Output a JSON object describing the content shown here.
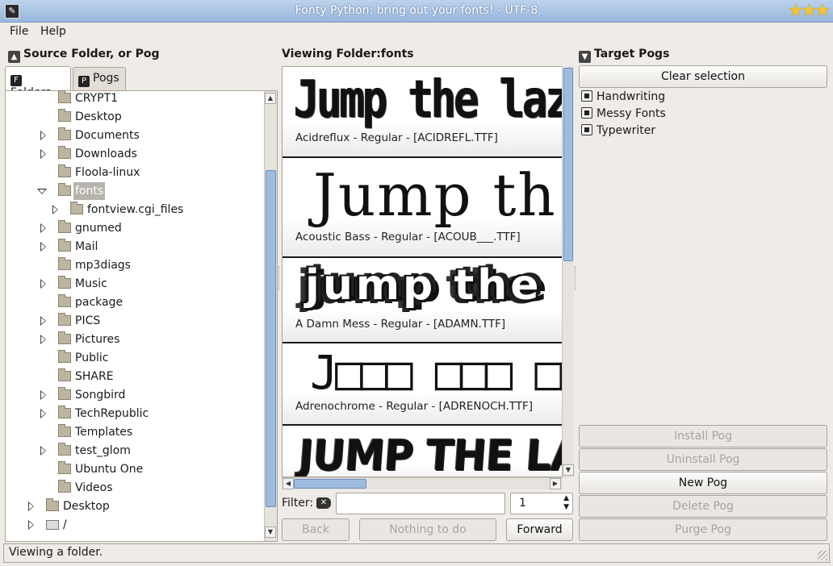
{
  "window": {
    "title": "Fonty Python: bring out your fonts!   -   UTF-8"
  },
  "menu": [
    {
      "label": "File"
    },
    {
      "label": "Help"
    }
  ],
  "source": {
    "heading": "Source Folder, or Pog",
    "tabs": [
      {
        "label": "Folders",
        "active": true
      },
      {
        "label": "Pogs",
        "active": false
      }
    ],
    "tree": [
      {
        "label": "CRYPT1",
        "depth": 1,
        "expander": "none"
      },
      {
        "label": "Desktop",
        "depth": 1,
        "expander": "none"
      },
      {
        "label": "Documents",
        "depth": 1,
        "expander": "closed"
      },
      {
        "label": "Downloads",
        "depth": 1,
        "expander": "closed"
      },
      {
        "label": "Floola-linux",
        "depth": 1,
        "expander": "none"
      },
      {
        "label": "fonts",
        "depth": 1,
        "expander": "open",
        "selected": true
      },
      {
        "label": "fontview.cgi_files",
        "depth": 2,
        "expander": "closed"
      },
      {
        "label": "gnumed",
        "depth": 1,
        "expander": "closed"
      },
      {
        "label": "Mail",
        "depth": 1,
        "expander": "closed"
      },
      {
        "label": "mp3diags",
        "depth": 1,
        "expander": "none"
      },
      {
        "label": "Music",
        "depth": 1,
        "expander": "closed"
      },
      {
        "label": "package",
        "depth": 1,
        "expander": "none"
      },
      {
        "label": "PICS",
        "depth": 1,
        "expander": "closed"
      },
      {
        "label": "Pictures",
        "depth": 1,
        "expander": "closed"
      },
      {
        "label": "Public",
        "depth": 1,
        "expander": "none"
      },
      {
        "label": "SHARE",
        "depth": 1,
        "expander": "none"
      },
      {
        "label": "Songbird",
        "depth": 1,
        "expander": "closed"
      },
      {
        "label": "TechRepublic",
        "depth": 1,
        "expander": "closed"
      },
      {
        "label": "Templates",
        "depth": 1,
        "expander": "none"
      },
      {
        "label": "test_glom",
        "depth": 1,
        "expander": "closed"
      },
      {
        "label": "Ubuntu One",
        "depth": 1,
        "expander": "none"
      },
      {
        "label": "Videos",
        "depth": 1,
        "expander": "none"
      },
      {
        "label": "Desktop",
        "depth": 0,
        "expander": "closed"
      },
      {
        "label": "/",
        "depth": 0,
        "expander": "closed",
        "icon": "drive"
      }
    ]
  },
  "viewer": {
    "heading": "Viewing Folder:fonts",
    "fonts": [
      {
        "sample": "Jump the laz",
        "label": "Acidreflux - Regular - [ACIDREFL.TTF]"
      },
      {
        "sample": "Jump th",
        "label": "Acoustic Bass - Regular - [ACOUB___.TTF]"
      },
      {
        "sample": "jump the",
        "label": "A Damn Mess - Regular - [ADAMN.TTF]"
      },
      {
        "sample": "J□□□ □□□ □□",
        "label": "Adrenochrome - Regular - [ADRENOCH.TTF]"
      },
      {
        "sample": "JUMP THE LAZY D",
        "label": ""
      }
    ],
    "filter_label": "Filter:",
    "filter_value": "",
    "page_value": "1",
    "buttons": {
      "back": "Back",
      "nothing": "Nothing to do",
      "forward": "Forward"
    }
  },
  "target": {
    "heading": "Target Pogs",
    "clear_label": "Clear selection",
    "pogs": [
      {
        "label": "Handwriting"
      },
      {
        "label": "Messy Fonts"
      },
      {
        "label": "Typewriter"
      }
    ],
    "buttons": {
      "install": "Install Pog",
      "uninstall": "Uninstall Pog",
      "new": "New Pog",
      "delete": "Delete Pog",
      "purge": "Purge Pog"
    }
  },
  "status": {
    "text": "Viewing a folder."
  },
  "colors": {
    "accent_blue": "#9ebbe0",
    "selection_gray": "#b7b3ad",
    "window_bg": "#efebe7"
  }
}
